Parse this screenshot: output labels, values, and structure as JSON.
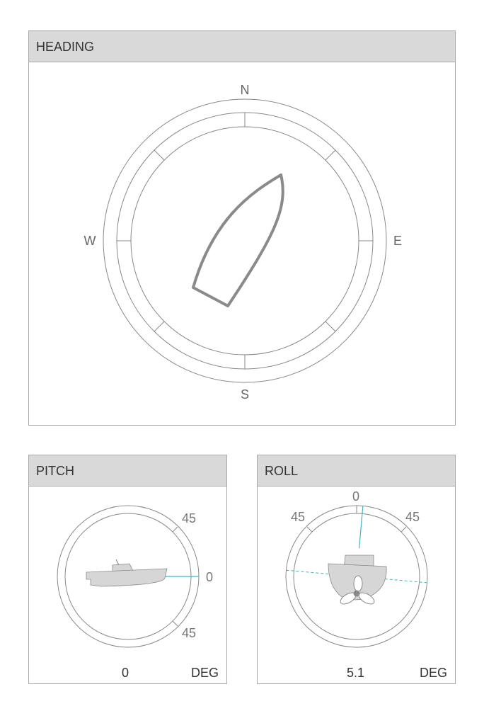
{
  "heading": {
    "title": "HEADING",
    "cardinals": {
      "north": "N",
      "east": "E",
      "south": "S",
      "west": "W"
    },
    "boat_icon": "boat-top-view-icon"
  },
  "pitch": {
    "title": "PITCH",
    "scale_labels": {
      "upper": "45",
      "level": "0",
      "lower": "45"
    },
    "value": "0",
    "unit": "DEG",
    "boat_icon": "boat-side-view-icon"
  },
  "roll": {
    "title": "ROLL",
    "scale_labels": {
      "top": "0",
      "left": "45",
      "right": "45"
    },
    "value": "5.1",
    "unit": "DEG",
    "boat_icon": "boat-stern-view-icon"
  },
  "colors": {
    "header_bg": "#d9d9d9",
    "ring_stroke": "#888888",
    "boat_outline": "#8a8a8a",
    "boat_fill": "#d6d6d6",
    "reference_line": "#3fb6c4"
  }
}
